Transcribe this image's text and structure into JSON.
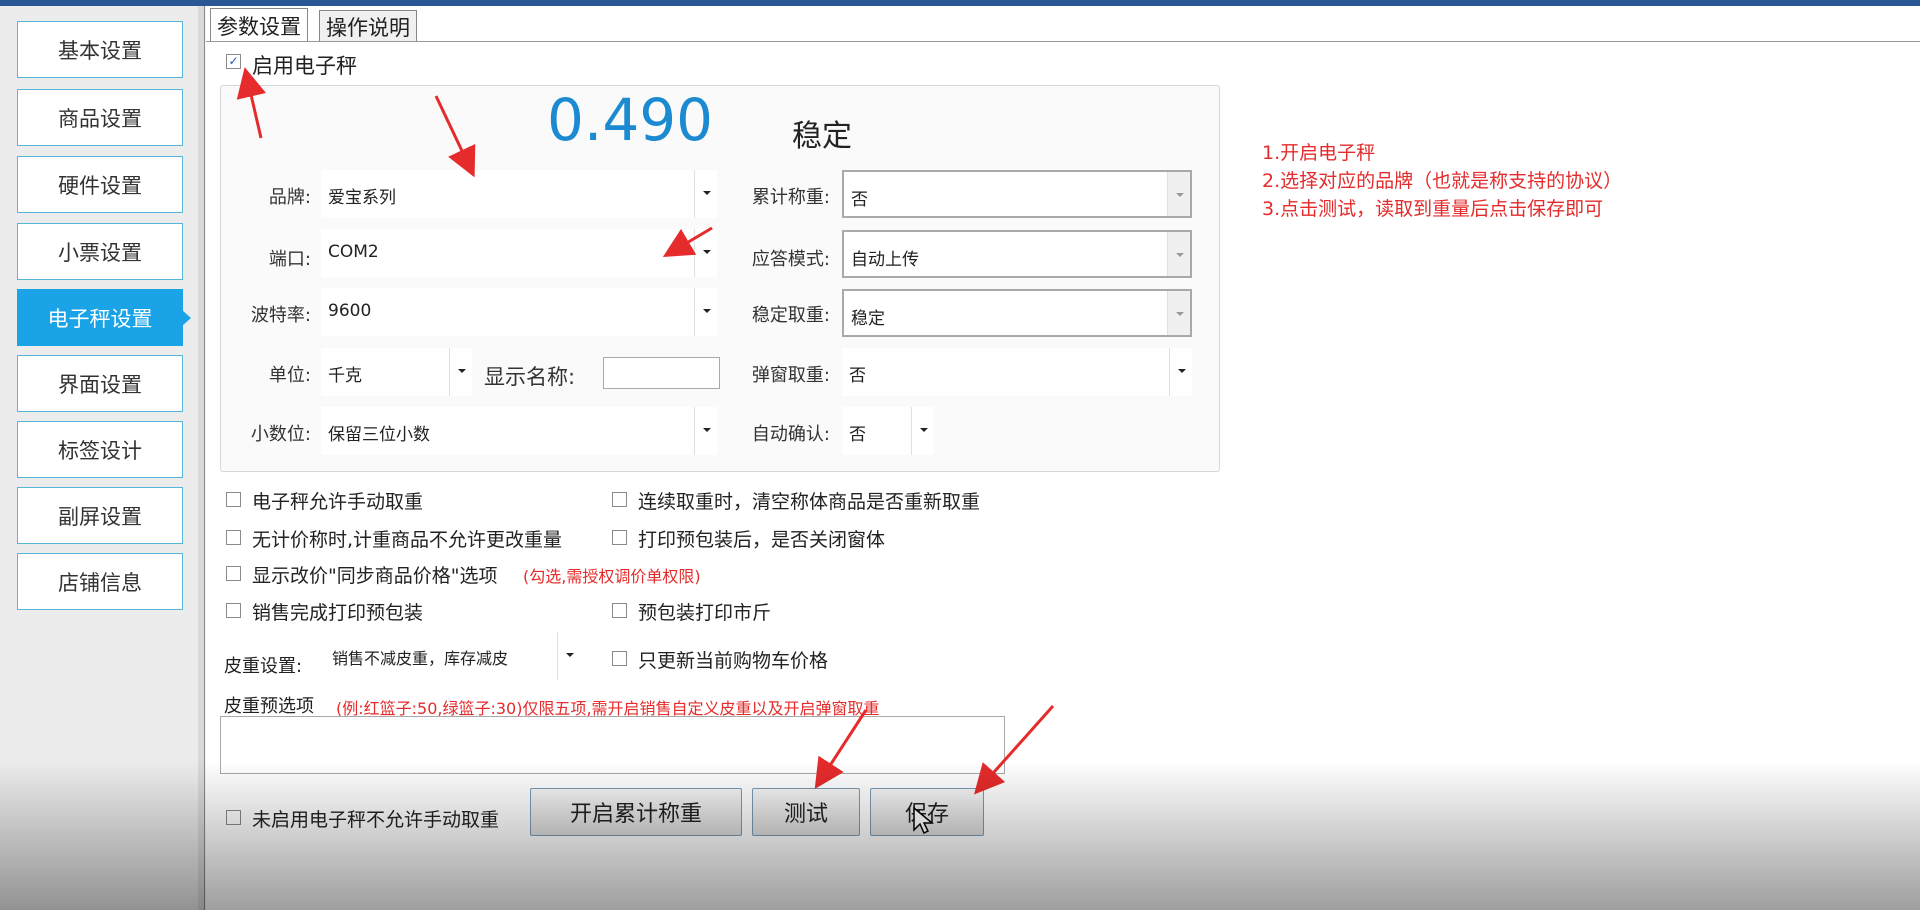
{
  "sidebar": {
    "items": [
      {
        "label": "基本设置"
      },
      {
        "label": "商品设置"
      },
      {
        "label": "硬件设置"
      },
      {
        "label": "小票设置"
      },
      {
        "label": "电子秤设置"
      },
      {
        "label": "界面设置"
      },
      {
        "label": "标签设计"
      },
      {
        "label": "副屏设置"
      },
      {
        "label": "店铺信息"
      }
    ],
    "active_index": 4
  },
  "tabs": [
    "参数设置",
    "操作说明"
  ],
  "enable_scale": {
    "label": "启用电子秤",
    "checked": true
  },
  "reading": {
    "weight": "0.490",
    "status": "稳定",
    "weight_color": "#1b8ad1"
  },
  "fields": {
    "brand": {
      "label": "品牌:",
      "value": "爱宝系列"
    },
    "port": {
      "label": "端口:",
      "value": "COM2"
    },
    "baud": {
      "label": "波特率:",
      "value": "9600"
    },
    "unit": {
      "label": "单位:",
      "value": "千克"
    },
    "display_name": {
      "label": "显示名称:",
      "value": ""
    },
    "decimals": {
      "label": "小数位:",
      "value": "保留三位小数"
    },
    "cumulative": {
      "label": "累计称重:",
      "value": "否"
    },
    "reply_mode": {
      "label": "应答模式:",
      "value": "自动上传"
    },
    "stable": {
      "label": "稳定取重:",
      "value": "稳定"
    },
    "popup": {
      "label": "弹窗取重:",
      "value": "否"
    },
    "auto_confirm": {
      "label": "自动确认:",
      "value": "否"
    }
  },
  "options": [
    {
      "label": "电子秤允许手动取重",
      "checked": false
    },
    {
      "label": "连续取重时，清空称体商品是否重新取重",
      "checked": false
    },
    {
      "label": "无计价称时,计重商品不允许更改重量",
      "checked": false
    },
    {
      "label": "打印预包装后，是否关闭窗体",
      "checked": false
    },
    {
      "label": "显示改价\"同步商品价格\"选项",
      "checked": false,
      "hint": "(勾选,需授权调价单权限)"
    },
    {
      "label": "销售完成打印预包装",
      "checked": false
    },
    {
      "label": "预包装打印市斤",
      "checked": false
    },
    {
      "label": "只更新当前购物车价格",
      "checked": false
    }
  ],
  "tare": {
    "label": "皮重设置:",
    "value": "销售不减皮重，库存减皮",
    "preset_label": "皮重预选项",
    "preset_hint": "(例:红篮子:50,绿篮子:30)仅限五项,需开启销售自定义皮重以及开启弹窗取重",
    "preset_value": ""
  },
  "bottom": {
    "no_scale_label": "未启用电子秤不允许手动取重",
    "buttons": {
      "cumulative": "开启累计称重",
      "test": "测试",
      "save": "保存"
    }
  },
  "notes": [
    "1.开启电子秤",
    "2.选择对应的品牌（也就是称支持的协议）",
    "3.点击测试，读取到重量后点击保存即可"
  ],
  "colors": {
    "accent": "#1aa3e6",
    "annotation": "#e52b2b"
  }
}
